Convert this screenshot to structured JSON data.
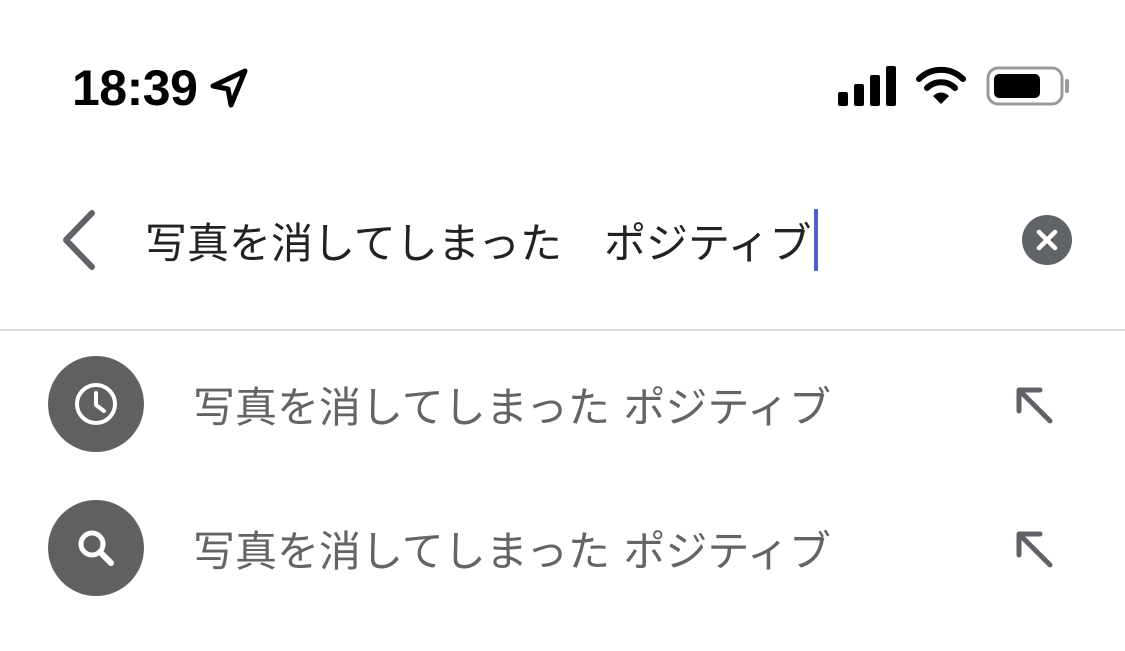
{
  "status_bar": {
    "time": "18:39",
    "icons": [
      "location-arrow-icon",
      "cellular-signal-icon",
      "wifi-icon",
      "battery-icon"
    ]
  },
  "search": {
    "query": "写真を消してしまった　ポジティブ",
    "back_icon": "chevron-left-icon",
    "clear_icon": "clear-circle-icon",
    "caret_color": "#4c5fd7"
  },
  "suggestions": [
    {
      "icon": "history-clock-icon",
      "text": "写真を消してしまった ポジティブ",
      "action_icon": "arrow-up-left-icon"
    },
    {
      "icon": "search-icon",
      "text": "写真を消してしまった ポジティブ",
      "action_icon": "arrow-up-left-icon"
    }
  ],
  "colors": {
    "icon_circle": "#606060",
    "suggestion_text": "#646464",
    "divider": "#dcdcdc"
  }
}
